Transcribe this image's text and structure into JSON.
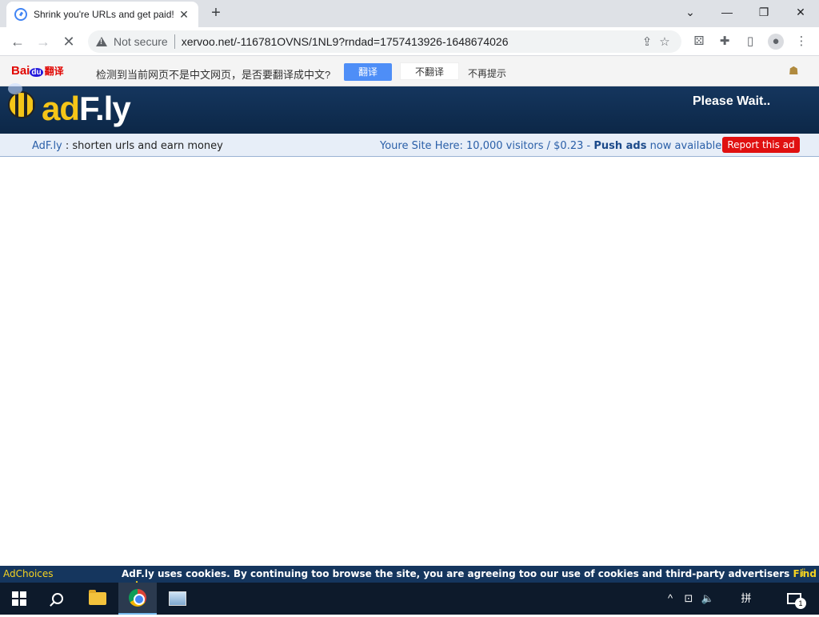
{
  "browser": {
    "tab_title": "Shrink you're URLs and get paid!",
    "tab_close": "✕",
    "new_tab": "+",
    "not_secure": "Not secure",
    "url": "xervoo.net/-116781OVNS/1NL9?rndad=1757413926-1648674026",
    "window_controls": {
      "chevron": "⌄",
      "minimize": "—",
      "restore": "❐",
      "close": "✕"
    }
  },
  "translate_bar": {
    "logo_bai": "Bai",
    "logo_du": "du",
    "logo_fanyi": "翻译",
    "message": "检测到当前网页不是中文网页，是否要翻译成中文?",
    "translate_label": "翻译",
    "no_translate_label": "不翻译",
    "never_label": "不再提示"
  },
  "adfly": {
    "logo_ad": "ad",
    "logo_fly": "F.ly",
    "please_wait": "Please Wait..",
    "tagline_brand": "AdF.ly",
    "tagline_rest": " : shorten urls and earn money",
    "promo_prefix": "Youre Site Here: 10,000 visitors / $0.23 - ",
    "promo_push": "Push ads",
    "promo_suffix": " now available!",
    "report_label": "Report this ad"
  },
  "cookie_bar": {
    "adchoices": "AdChoices",
    "text": "AdF.ly uses cookies. By continuing too browse the site, you are agreeing too our use of cookies and third-party advertisers ",
    "find_out": "Find out more.",
    "close": "ⅱ"
  },
  "taskbar": {
    "ime_label": "拼",
    "notification_count": "1"
  }
}
